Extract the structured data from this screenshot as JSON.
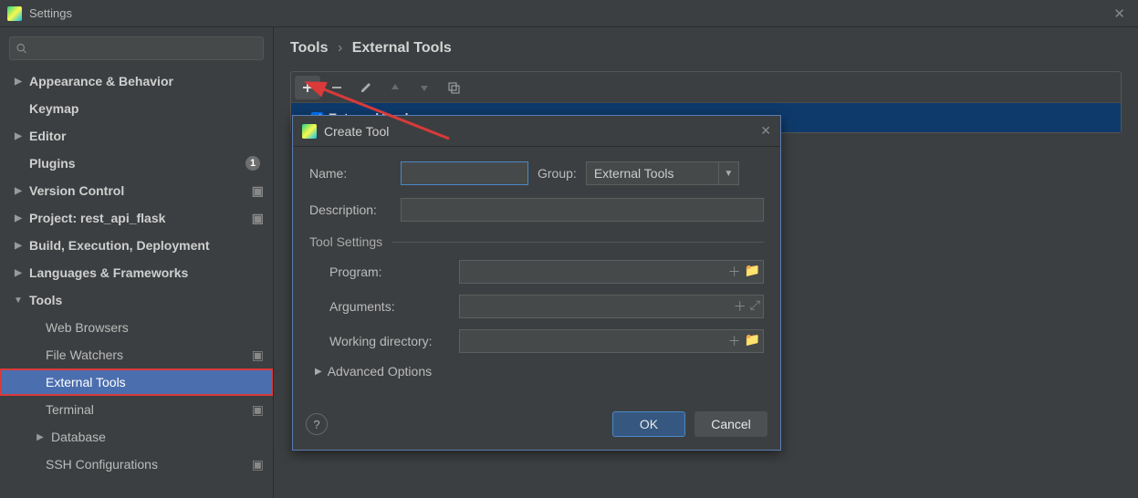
{
  "window": {
    "title": "Settings"
  },
  "sidebar": {
    "items": [
      {
        "label": "Appearance & Behavior",
        "arrow": "▶"
      },
      {
        "label": "Keymap"
      },
      {
        "label": "Editor",
        "arrow": "▶"
      },
      {
        "label": "Plugins",
        "badge": "1"
      },
      {
        "label": "Version Control",
        "arrow": "▶",
        "proj": true
      },
      {
        "label": "Project: rest_api_flask",
        "arrow": "▶",
        "proj": true
      },
      {
        "label": "Build, Execution, Deployment",
        "arrow": "▶"
      },
      {
        "label": "Languages & Frameworks",
        "arrow": "▶"
      },
      {
        "label": "Tools",
        "arrow": "▼"
      }
    ],
    "tools_children": [
      {
        "label": "Web Browsers"
      },
      {
        "label": "File Watchers",
        "proj": true
      },
      {
        "label": "External Tools",
        "selected": true
      },
      {
        "label": "Terminal",
        "proj": true
      },
      {
        "label": "Database",
        "arrow": "▶"
      },
      {
        "label": "SSH Configurations",
        "proj": true
      }
    ]
  },
  "breadcrumb": {
    "root": "Tools",
    "leaf": "External Tools"
  },
  "list": {
    "group_label": "External Tools",
    "group_checked": true
  },
  "dialog": {
    "title": "Create Tool",
    "labels": {
      "name": "Name:",
      "group": "Group:",
      "description": "Description:",
      "tool_settings": "Tool Settings",
      "program": "Program:",
      "arguments": "Arguments:",
      "working_dir": "Working directory:",
      "advanced": "Advanced Options"
    },
    "values": {
      "name": "",
      "group": "External Tools",
      "description": "",
      "program": "",
      "arguments": "",
      "working_dir": ""
    },
    "buttons": {
      "ok": "OK",
      "cancel": "Cancel"
    }
  }
}
